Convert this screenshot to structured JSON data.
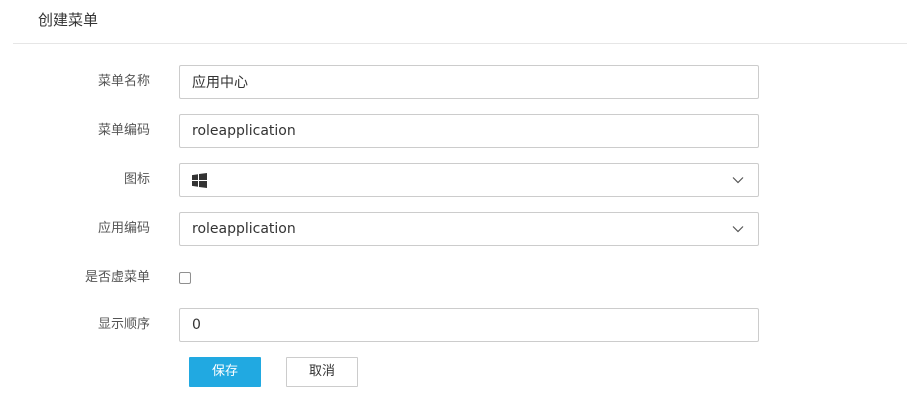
{
  "page": {
    "title": "创建菜单"
  },
  "form": {
    "menu_name": {
      "label": "菜单名称",
      "value": "应用中心"
    },
    "menu_code": {
      "label": "菜单编码",
      "value": "roleapplication"
    },
    "icon": {
      "label": "图标",
      "selected_icon": "windows-icon"
    },
    "app_code": {
      "label": "应用编码",
      "value": "roleapplication"
    },
    "virtual_menu": {
      "label": "是否虚菜单",
      "checked": false
    },
    "display_order": {
      "label": "显示顺序",
      "value": "0"
    }
  },
  "actions": {
    "save_label": "保存",
    "cancel_label": "取消"
  },
  "colors": {
    "primary": "#21a9e1",
    "border": "#cccccc",
    "divider": "#e6e6e6"
  }
}
